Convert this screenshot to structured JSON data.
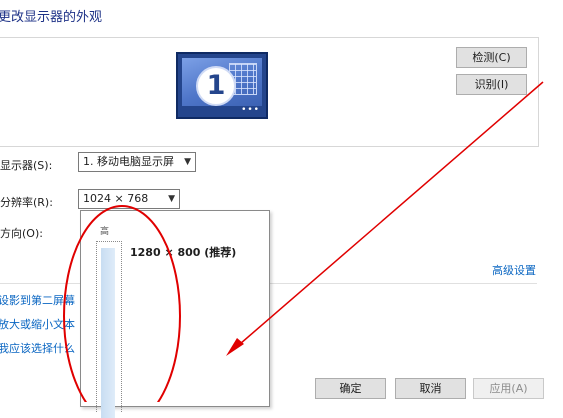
{
  "header": {
    "title": "更改显示器的外观"
  },
  "preview": {
    "monitor_number": "1"
  },
  "buttons": {
    "detect": "检测(C)",
    "identify": "识别(I)",
    "ok": "确定",
    "cancel": "取消",
    "apply": "应用(A)"
  },
  "settings": {
    "display_label": "显示器(S):",
    "display_value": "1. 移动电脑显示屏",
    "resolution_label": "分辨率(R):",
    "resolution_value": "1024 × 768",
    "orientation_label": "方向(O):"
  },
  "resolution_dropdown": {
    "high_label": "高",
    "recommended_option": "1280 × 800 (推荐)"
  },
  "links": {
    "advanced": "高级设置",
    "project": "设影到第二屏幕",
    "text_size": "放大或缩小文本",
    "which": "我应该选择什么"
  },
  "annotation": {
    "color": "#e00000"
  }
}
